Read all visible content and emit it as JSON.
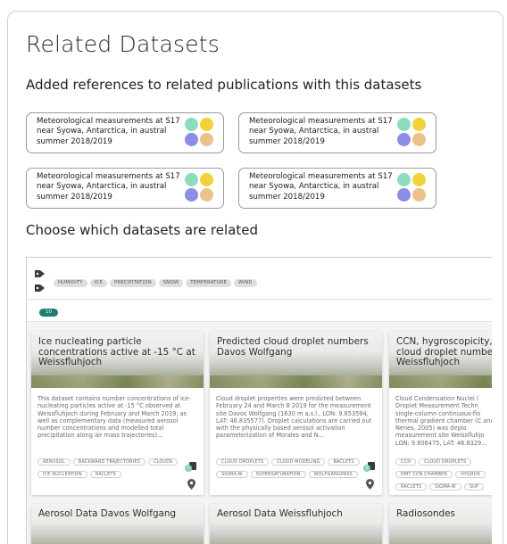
{
  "page": {
    "title": "Related Datasets",
    "references_heading": "Added references to related publications with this datasets",
    "choose_heading": "Choose which datasets are related"
  },
  "references": [
    {
      "text": "Meteorological measurements at S17 near Syowa, Antarctica, in austral summer 2018/2019"
    },
    {
      "text": "Meteorological measurements at S17 near Syowa, Antarctica, in austral summer 2018/2019"
    },
    {
      "text": "Meteorological measurements at S17 near Syowa, Antarctica, in austral summer 2018/2019"
    },
    {
      "text": "Meteorological measurements at S17 near Syowa, Antarctica, in austral summer 2018/2019"
    }
  ],
  "colors": {
    "dot_teal": "#8edcbe",
    "dot_yellow": "#f1d23a",
    "dot_purple": "#8c8ee6",
    "dot_orange": "#edc28a",
    "count_badge": "#1f7f6e"
  },
  "filters": {
    "tags": [
      "HUMIDITY",
      "ICE",
      "PRECIPITATION",
      "SNOW",
      "TEMPERATURE",
      "WIND"
    ],
    "icons": [
      "tag-icon",
      "tag-icon"
    ]
  },
  "result_count": "10",
  "datasets": [
    {
      "title": "Ice nucleating particle concentrations active at -15 °C at Weissfluhjoch",
      "description": "This dataset contains number concentrations of ice-nucleating particles active at -15 °C observed at Weissfluhjoch during February and March 2019, as well as complementary data (measured aerosol number concentrations and modelled total precipitation along air mass trajectories)...",
      "keywords": [
        "AEROSOL",
        "BACKWARD TRAJECTORIES",
        "CLOUDS",
        "ICE NUCLEATION",
        "RACLETS"
      ],
      "stack_count": "1"
    },
    {
      "title": "Predicted cloud droplet numbers Davos Wolfgang",
      "description": "Cloud droplet properties were predicted between February 24 and March 8 2019 for the measurement site Davos Wolfgang (1630 m a.s.l., LON: 9.853594, LAT: 46.835577). Droplet calculations are carried out with the physically based aerosol activation parameterization of Morales and N...",
      "keywords": [
        "CLOUD DROPLETS",
        "CLOUD MODELING",
        "RACLETS",
        "SIGMA-W",
        "SUPERSATURATION",
        "WOLFGANGPASS"
      ],
      "stack_count": "2"
    },
    {
      "title": "CCN, hygroscopicity, cloud droplet numbe Weissfluhjoch",
      "description": "Cloud Condensation Nuclei ( Droplet Measurement Techn single-column continuous-flo thermal gradient chamber (C and Nenes, 2005) was deplo measurement site Weissfluhjo LON: 9.806475, LAT: 46.8329...",
      "keywords": [
        "CCN",
        "CLOUD DROPLETS",
        "DMT CCN CHAMBER",
        "HYGROS",
        "RACLETS",
        "SIGMA-W",
        "SUP"
      ],
      "stack_count": ""
    },
    {
      "title": "Aerosol Data Davos Wolfgang"
    },
    {
      "title": "Aerosol Data Weissfluhjoch"
    },
    {
      "title": "Radiosondes"
    }
  ]
}
